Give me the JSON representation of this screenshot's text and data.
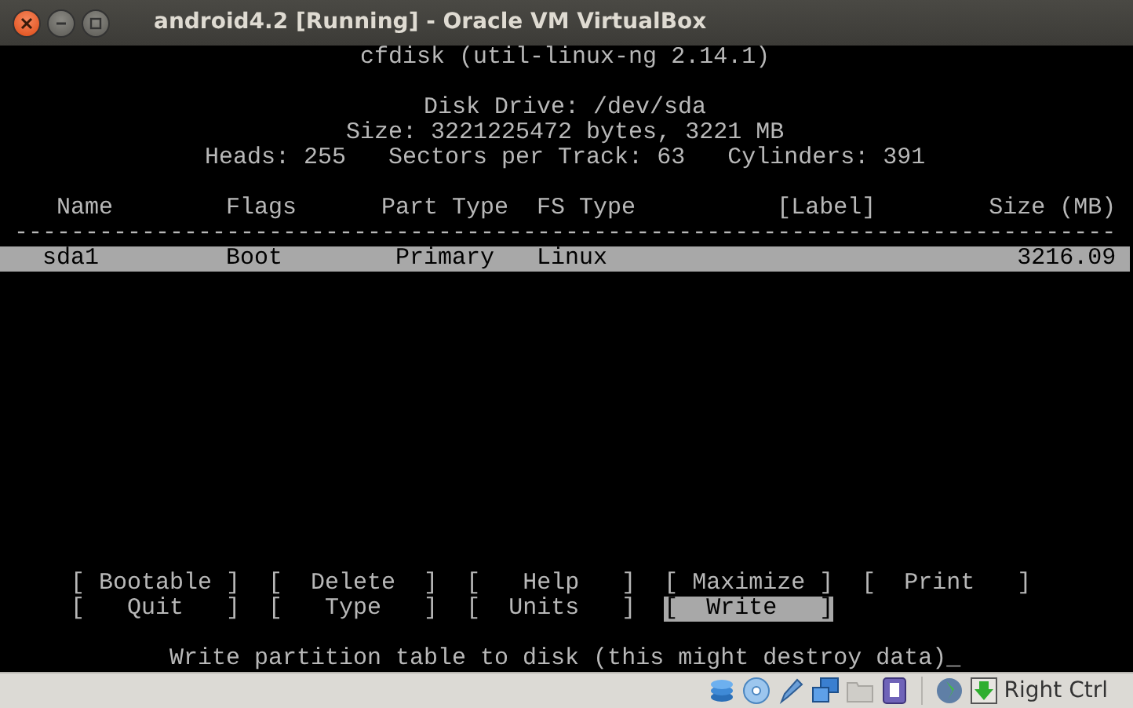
{
  "window": {
    "title": "android4.2 [Running] - Oracle VM VirtualBox"
  },
  "console": {
    "program_line": "cfdisk (util-linux-ng 2.14.1)",
    "disk_lines": [
      "Disk Drive: /dev/sda",
      "Size: 3221225472 bytes, 3221 MB",
      "Heads: 255   Sectors per Track: 63   Cylinders: 391"
    ],
    "table": {
      "columns": [
        "Name",
        "Flags",
        "Part Type",
        "FS Type",
        "[Label]",
        "Size (MB)"
      ],
      "separator": "------------------------------------------------------------------------------",
      "rows": [
        {
          "name": "sda1",
          "flags": "Boot",
          "part_type": "Primary",
          "fs_type": "Linux",
          "size": "3216.09",
          "selected": true
        }
      ]
    },
    "menu": [
      [
        {
          "text": "[ Bootable ]",
          "selected": false
        },
        {
          "text": "[  Delete  ]",
          "selected": false
        },
        {
          "text": "[   Help   ]",
          "selected": false
        },
        {
          "text": "[ Maximize ]",
          "selected": false
        },
        {
          "text": "[  Print   ]",
          "selected": false
        }
      ],
      [
        {
          "text": "[   Quit   ]",
          "selected": false
        },
        {
          "text": "[   Type   ]",
          "selected": false
        },
        {
          "text": "[  Units   ]",
          "selected": false
        },
        {
          "text": "[  Write   ]",
          "selected": true
        }
      ]
    ],
    "hint": "Write partition table to disk (this might destroy data)_"
  },
  "status_bar": {
    "host_key": "Right Ctrl"
  }
}
